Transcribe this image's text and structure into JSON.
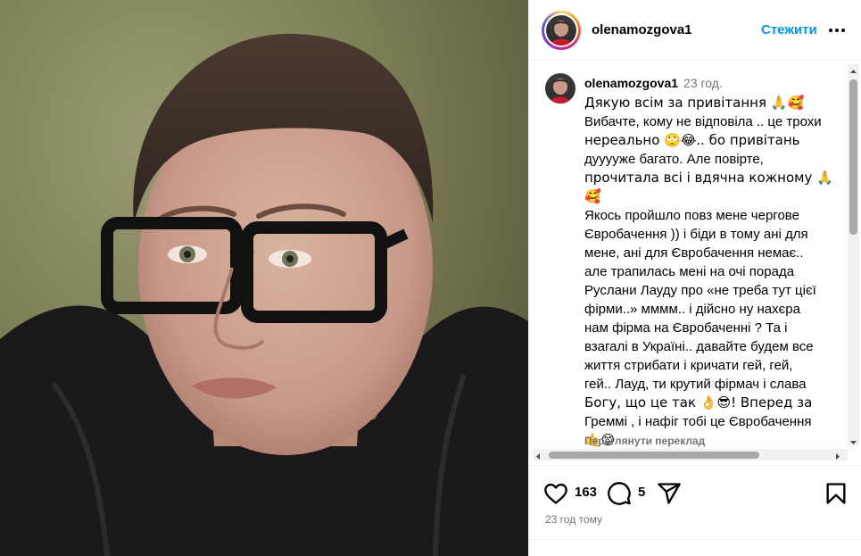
{
  "post": {
    "username": "olenamozgova1",
    "follow_label": "Стежити",
    "more_icon": "more-horizontal-icon"
  },
  "caption": {
    "username": "olenamozgova1",
    "time": "23 год.",
    "lines": [
      "Дякую всім за привітання 🙏🥰",
      "Вибачте, кому не відповіла .. це трохи",
      "нереально 🙄😂.. бо привітань",
      "дууууже багато. Але повірте,",
      "прочитала всі і вдячна кожному 🙏",
      "🥰",
      "Якось пройшло повз мене чергове",
      "Євробачення )) і біди в тому ані для",
      "мене, ані для Євробачення немає..",
      "але трапилась мені на очі порада",
      "Руслани Лауду про «не треба тут цієї",
      "фірми..» мммм.. і дійсно ну нахєра",
      "нам фірма на Євробаченні ? Та і",
      "взагалі в Україні.. давайте будем все",
      "життя стрибати і кричати гей, гей,",
      "гей.. Лауд, ти крутий фірмач і слава",
      "Богу, що це так 👌😎! Вперед за",
      "Греммі , і нафіг тобі це Євробачення",
      "🤙😊"
    ],
    "translate_label": "Переглянути переклад"
  },
  "actions": {
    "like_icon": "heart-icon",
    "likes": "163",
    "comment_icon": "comment-icon",
    "comments": "5",
    "share_icon": "send-icon",
    "save_icon": "bookmark-icon"
  },
  "posted_ago": "23 год тому",
  "colors": {
    "accent": "#0095f6",
    "muted": "#737373",
    "divider": "#efefef"
  }
}
